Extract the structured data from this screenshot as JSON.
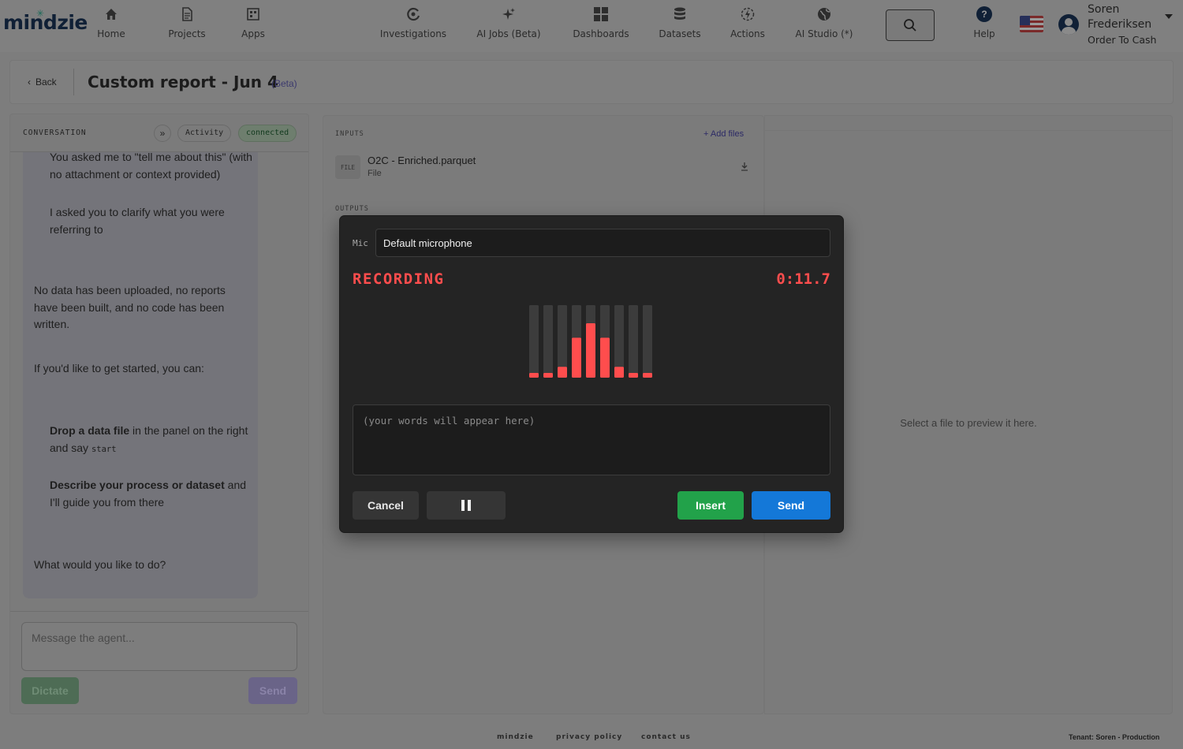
{
  "brand": {
    "logo": "mindzie"
  },
  "nav": {
    "items": [
      {
        "label": "Home",
        "icon": "home-icon"
      },
      {
        "label": "Projects",
        "icon": "document-icon"
      },
      {
        "label": "Apps",
        "icon": "apps-icon"
      },
      {
        "label": "Investigations",
        "icon": "investigations-icon"
      },
      {
        "label": "AI Jobs (Beta)",
        "icon": "sparkle-icon"
      },
      {
        "label": "Dashboards",
        "icon": "dashboard-grid-icon"
      },
      {
        "label": "Datasets",
        "icon": "database-icon"
      },
      {
        "label": "Actions",
        "icon": "actions-icon"
      },
      {
        "label": "AI Studio (*)",
        "icon": "globe-icon"
      }
    ],
    "help_label": "Help",
    "help_glyph": "?"
  },
  "user": {
    "first_name": "Soren",
    "last_name": "Frederiksen",
    "tenant_name": "Order To Cash"
  },
  "header": {
    "back_label": "Back",
    "title": "Custom report - Jun 4",
    "beta_label": "(Beta)"
  },
  "conversation": {
    "title": "CONVERSATION",
    "collapse_glyph": "»",
    "activity_label": "Activity",
    "status_label": "connected",
    "messages": {
      "m1": "You asked me to \"tell me about this\" (with no attachment or context provided)",
      "m2": "I asked you to clarify what you were referring to",
      "m3": "No data has been uploaded, no reports have been built, and no code has been written.",
      "m4": "If you'd like to get started, you can:",
      "m5_bold": "Drop a data file",
      "m5_rest": " in the panel on the right and say ",
      "m5_code": "start",
      "m6_bold": "Describe your process or dataset",
      "m6_rest": " and I'll guide you from there",
      "m7": "What would you like to do?"
    },
    "composer_placeholder": "Message the agent...",
    "dictate_label": "Dictate",
    "send_label": "Send"
  },
  "inputs_panel": {
    "inputs_label": "INPUTS",
    "add_files_label": "+ Add files",
    "file_badge": "FILE",
    "file_name": "O2C - Enriched.parquet",
    "file_type": "File",
    "outputs_label": "OUTPUTS"
  },
  "preview": {
    "hint": "Select a file to preview it here."
  },
  "footer": {
    "links": [
      "mindzie",
      "privacy policy",
      "contact us"
    ],
    "tenant": "Tenant: Soren - Production"
  },
  "recorder": {
    "mic_label": "Mic",
    "mic_value": "Default microphone",
    "status": "RECORDING",
    "timer": "0:11.7",
    "level_bars": [
      0.05,
      0.05,
      0.15,
      0.55,
      0.75,
      0.55,
      0.15,
      0.05,
      0.05
    ],
    "transcript_placeholder": "(your words will appear here)",
    "cancel_label": "Cancel",
    "pause_glyph": "❚❚",
    "insert_label": "Insert",
    "send_label": "Send",
    "colors": {
      "active_level": "#ff4d4d",
      "track": "#3c3c3c",
      "insert": "#22a24a",
      "send": "#1478d8"
    }
  }
}
